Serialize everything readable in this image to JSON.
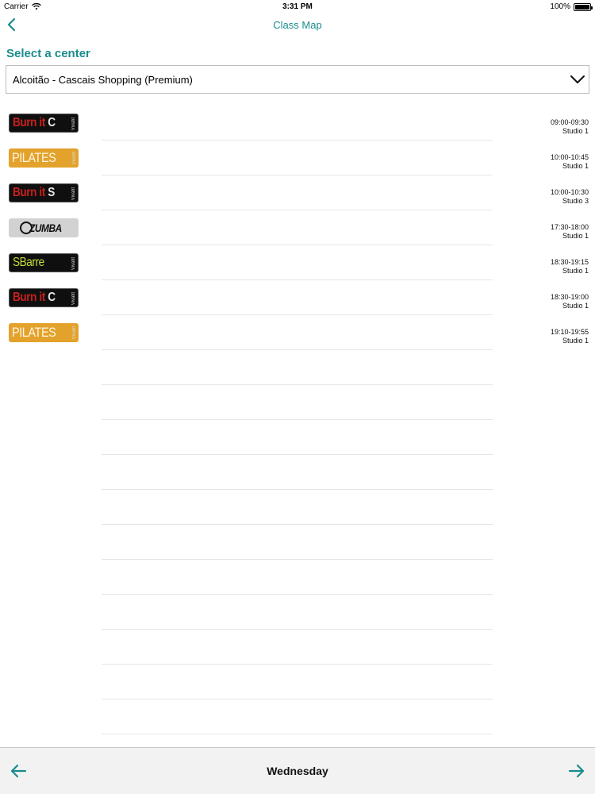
{
  "status_bar": {
    "carrier": "Carrier",
    "time": "3:31 PM",
    "battery": "100%"
  },
  "nav": {
    "title": "Class Map",
    "accent": "#1a8c8c"
  },
  "center": {
    "label": "Select a center",
    "selected": "Alcoitão - Cascais Shopping (Premium)"
  },
  "classes": [
    {
      "logo_text": "Burn it",
      "logo_suffix": "C",
      "time": "09:00-09:30",
      "studio": "Studio 1"
    },
    {
      "logo_text": "PILATES",
      "logo_suffix": "",
      "time": "10:00-10:45",
      "studio": "Studio 1"
    },
    {
      "logo_text": "Burn it",
      "logo_suffix": "S",
      "time": "10:00-10:30",
      "studio": "Studio 3"
    },
    {
      "logo_text": "ZUMBA",
      "logo_suffix": "",
      "time": "17:30-18:00",
      "studio": "Studio 1"
    },
    {
      "logo_text": "SBarre",
      "logo_suffix": "",
      "time": "18:30-19:15",
      "studio": "Studio 1"
    },
    {
      "logo_text": "Burn it",
      "logo_suffix": "C",
      "time": "18:30-19:00",
      "studio": "Studio 1"
    },
    {
      "logo_text": "PILATES",
      "logo_suffix": "",
      "time": "19:10-19:55",
      "studio": "Studio 1"
    }
  ],
  "footer": {
    "day": "Wednesday"
  }
}
